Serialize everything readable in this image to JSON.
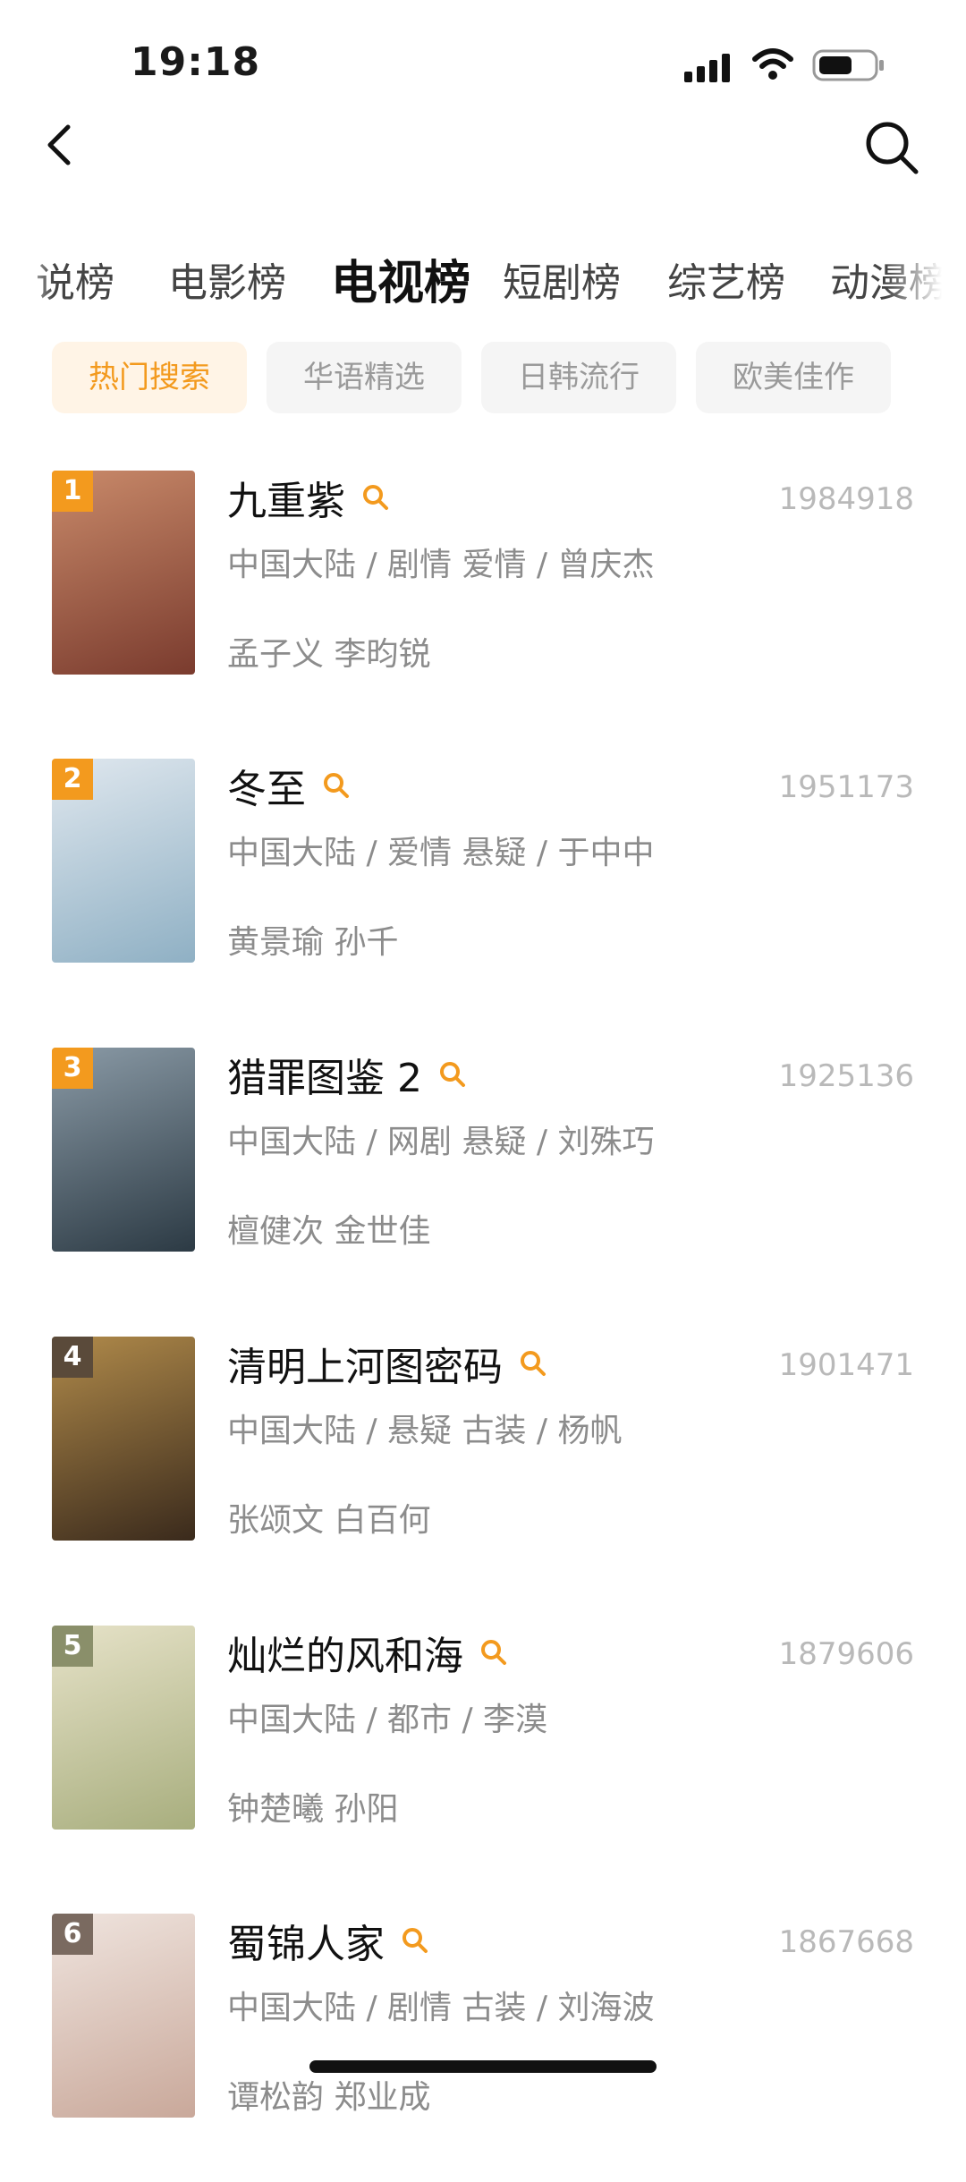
{
  "status_bar": {
    "time": "19:18"
  },
  "category_tabs": [
    {
      "label": "说榜",
      "active": false
    },
    {
      "label": "电影榜",
      "active": false
    },
    {
      "label": "电视榜",
      "active": true
    },
    {
      "label": "短剧榜",
      "active": false
    },
    {
      "label": "综艺榜",
      "active": false
    },
    {
      "label": "动漫榜",
      "active": false
    }
  ],
  "filter_chips": [
    {
      "label": "热门搜索",
      "active": true
    },
    {
      "label": "华语精选",
      "active": false
    },
    {
      "label": "日韩流行",
      "active": false
    },
    {
      "label": "欧美佳作",
      "active": false
    }
  ],
  "ranking": [
    {
      "rank": "1",
      "title": "九重紫",
      "count": "1984918",
      "meta": "中国大陆 / 剧情 爱情 / 曾庆杰",
      "cast": "孟子义 李昀锐",
      "badge_color": "#f39a1e",
      "poster_colors": [
        "#7a3b2e",
        "#c98a6a"
      ]
    },
    {
      "rank": "2",
      "title": "冬至",
      "count": "1951173",
      "meta": "中国大陆 / 爱情 悬疑 / 于中中",
      "cast": "黄景瑜 孙千",
      "badge_color": "#f39a1e",
      "poster_colors": [
        "#8fb0c4",
        "#dfe7ee"
      ]
    },
    {
      "rank": "3",
      "title": "猎罪图鉴 2",
      "count": "1925136",
      "meta": "中国大陆 / 网剧 悬疑 / 刘殊巧",
      "cast": "檀健次 金世佳",
      "badge_color": "#f39a1e",
      "poster_colors": [
        "#2c3a44",
        "#8a9aa6"
      ]
    },
    {
      "rank": "4",
      "title": "清明上河图密码",
      "count": "1901471",
      "meta": "中国大陆 / 悬疑 古装 / 杨帆",
      "cast": "张颂文 白百何",
      "badge_color": "#5a4a3a",
      "poster_colors": [
        "#3a2a1c",
        "#b08a4a"
      ]
    },
    {
      "rank": "5",
      "title": "灿烂的风和海",
      "count": "1879606",
      "meta": "中国大陆 / 都市 / 李漠",
      "cast": "钟楚曦 孙阳",
      "badge_color": "#8a8f6a",
      "poster_colors": [
        "#a8ae7e",
        "#e6e2c8"
      ]
    },
    {
      "rank": "6",
      "title": "蜀锦人家",
      "count": "1867668",
      "meta": "中国大陆 / 剧情 古装 / 刘海波",
      "cast": "谭松韵 郑业成",
      "badge_color": "#7a6a60",
      "poster_colors": [
        "#c9a89a",
        "#efe4de"
      ]
    }
  ]
}
